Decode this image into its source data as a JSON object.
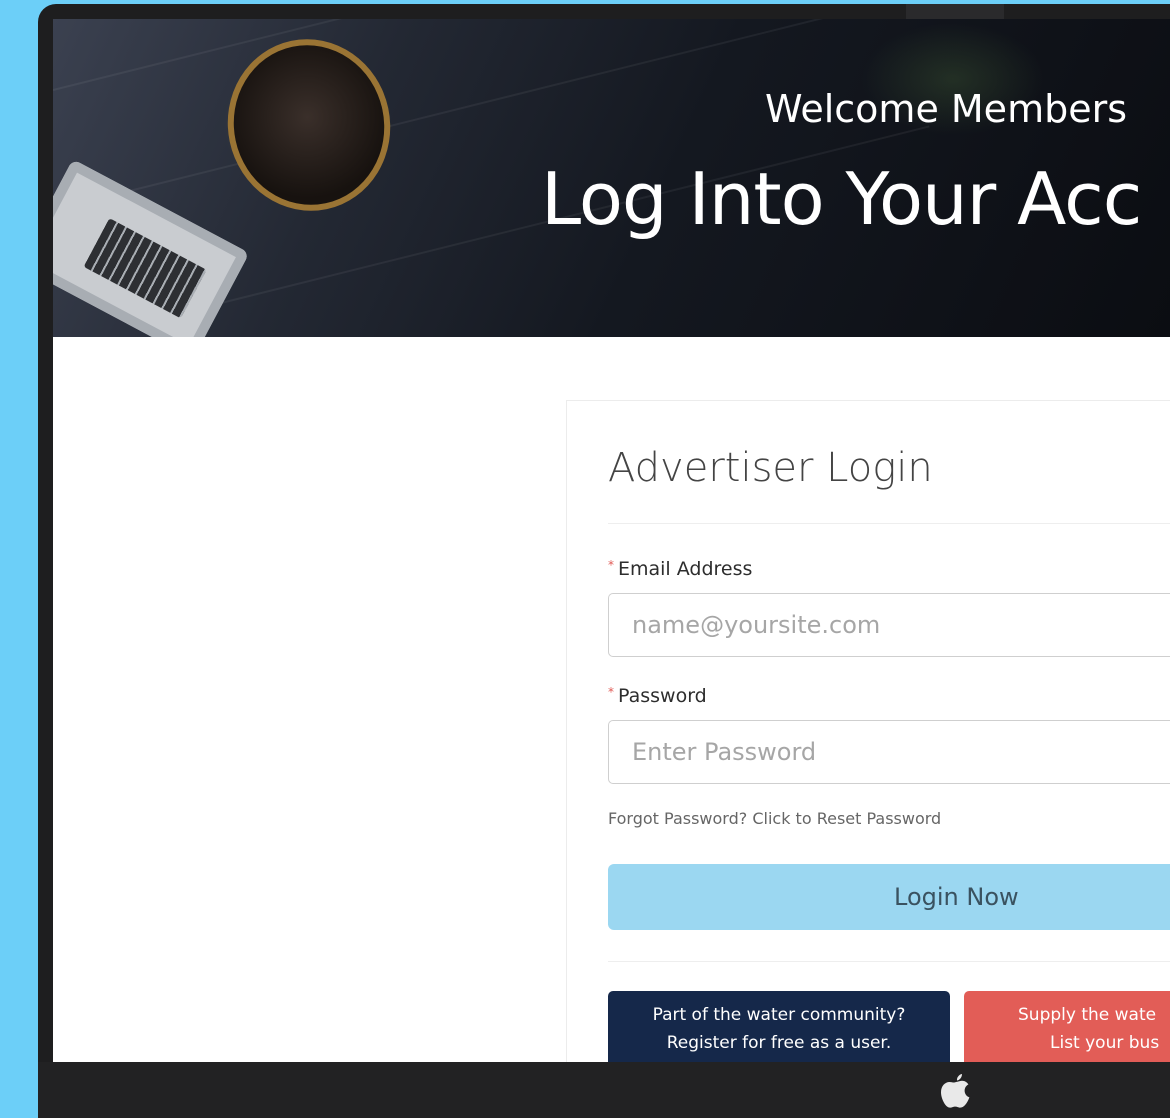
{
  "hero": {
    "subtitle": "Welcome Members",
    "title": "Log Into Your Acc"
  },
  "login": {
    "title": "Advertiser Login",
    "email_label": "Email Address",
    "email_placeholder": "name@yoursite.com",
    "email_value": "",
    "password_label": "Password",
    "password_placeholder": "Enter Password",
    "password_value": "",
    "required_marker": "*",
    "forgot_link": "Forgot Password? Click to Reset Password",
    "submit_label": "Login Now"
  },
  "cta": {
    "user_line1": "Part of the water community?",
    "user_line2": "Register for free as a user.",
    "business_line1": "Supply the wate",
    "business_line2": "List your bus"
  },
  "colors": {
    "page_background": "#6ccff8",
    "login_button": "#9bd7f1",
    "user_cta": "#15284a",
    "business_cta": "#e25d57"
  },
  "icons": {
    "dock_logo": "apple-icon"
  }
}
